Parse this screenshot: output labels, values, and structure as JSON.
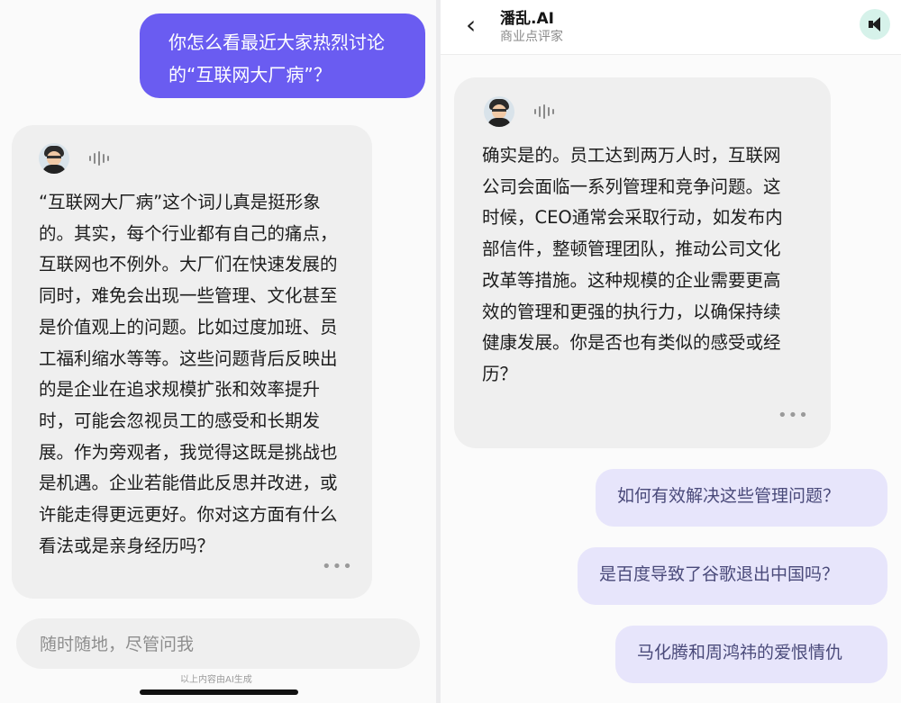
{
  "left": {
    "user_question": "你怎么看最近大家热烈讨论\n的“互联网大厂病”？",
    "bot_reply": "“互联网大厂病”这个词儿真是挺形象\n的。其实，每个行业都有自己的痛点，\n互联网也不例外。大厂们在快速发展的\n同时，难免会出现一些管理、文化甚至\n是价值观上的问题。比如过度加班、员\n工福利缩水等等。这些问题背后反映出\n的是企业在追求规模扩张和效率提升\n时，可能会忽视员工的感受和长期发\n展。作为旁观者，我觉得这既是挑战也\n是机遇。企业若能借此反思并改进，或\n许能走得更远更好。你对这方面有什么\n看法或是亲身经历吗？",
    "more": "•••",
    "input_placeholder": "随时随地，尽管问我",
    "ai_note": "以上内容由AI生成"
  },
  "right": {
    "header": {
      "back": "‹",
      "name": "潘乱.AI",
      "subtitle": "商业点评家"
    },
    "bot_reply": "确实是的。员工达到两万人时，互联网\n公司会面临一系列管理和竞争问题。这\n时候，CEO通常会采取行动，如发布内\n部信件，整顿管理团队，推动公司文化\n改革等措施。这种规模的企业需要更高\n效的管理和更强的执行力，以确保持续\n健康发展。你是否也有类似的感受或经\n历？",
    "more": "•••",
    "suggestions": [
      "如何有效解决这些管理问题？",
      "是百度导致了谷歌退出中国吗？",
      "马化腾和周鸿祎的爱恨情仇"
    ]
  },
  "icons": [
    "avatar",
    "voice-wave-icon",
    "more-icon",
    "back-icon",
    "speaker-icon"
  ],
  "colors": {
    "user_bubble": "#6a5cf1",
    "bot_card": "#efefef",
    "suggestion": "#e7e5fb",
    "speaker_bg": "#d6f2ea"
  }
}
